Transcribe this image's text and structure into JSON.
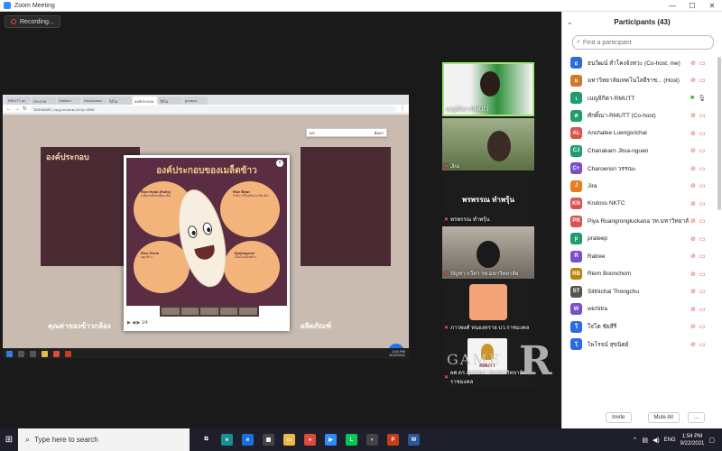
{
  "window": {
    "title": "Zoom Meeting",
    "minimize": "—",
    "maximize": "☐",
    "close": "✕"
  },
  "recording": {
    "label": "Recording..."
  },
  "shared_screen": {
    "tabs": [
      "RMUTT.ac",
      "ประกาศ",
      "Untitled",
      "Storyboard",
      "วิดีโอ",
      "องค์ประกอบ",
      "วิดีโอ",
      "product"
    ],
    "url": "ไม่ปลอดภัย | rspg.rmutt.ac.th/?p=4958",
    "find_bar": {
      "count": "0/0",
      "button": "ค้นหา"
    },
    "page": {
      "bg_title": "องค์ประกอบ",
      "bg_caption_left": "คุณค่าของข้าวกล้อง",
      "bg_caption_right": "ผลิตภัณฑ์",
      "lightbox": {
        "title": "องค์ประกอบของเมล็ดข้าว",
        "labels": [
          {
            "head": "Rice Husk (Hulls)",
            "text": "เปลือกแข็งห่อหุ้มเมล็ด"
          },
          {
            "head": "Rice Bran",
            "text": "รำข้าว มีไขมันและวิตามิน"
          },
          {
            "head": "Rice Germ",
            "text": "จมูกข้าว"
          },
          {
            "head": "Endosperm",
            "text": "เนื้อในเมล็ดข้าว"
          }
        ],
        "close": "×",
        "controls": "▶  ◀  ▶  1/4"
      },
      "messenger": "✉"
    },
    "taskbar_clock": {
      "time": "1:54 PM",
      "date": "9/22/2021"
    }
  },
  "gallery": [
    {
      "name": "เบญจิกิตา-RMUTT",
      "active": true,
      "mic_muted": false
    },
    {
      "name": "Jira",
      "active": false,
      "mic_muted": true
    },
    {
      "name": "พรพรรณ ทำพรุ้น",
      "active": false,
      "mic_muted": true,
      "center_text": "พรพรรณ ทำพรุ้น"
    },
    {
      "name": "บัญชา กวีลา  วท.มหาวิทยาลัย",
      "active": false,
      "mic_muted": true
    },
    {
      "name": "ภาวพงศ์ หนองทราย บว.ราชมงคล",
      "active": false,
      "mic_muted": true
    },
    {
      "name": "ผศ.ดร.สุวรรณา วท.มหาวิทยาลัยราชมงคล",
      "active": false,
      "mic_muted": true,
      "logo_text": "RMUTT"
    }
  ],
  "watermark": {
    "small": "GAME",
    "big": "R"
  },
  "participants": {
    "title": "Participants (43)",
    "search_placeholder": "Find a participant",
    "list": [
      {
        "initials": "ธ",
        "color": "#2d6cdf",
        "name": "ธนวัฒน์ สำโคงจังหวะ (Co-host, me)",
        "mic": "off",
        "cam": "off"
      },
      {
        "initials": "ม",
        "color": "#c97a2b",
        "name": "มหาวิทยาลัยเทคโนโลยีราช... (Host)",
        "mic": "off",
        "cam": "off"
      },
      {
        "initials": "เ",
        "color": "#1f9d6b",
        "name": "เบญจิกิตา-RMUTT",
        "mic": "on",
        "cam": "on"
      },
      {
        "initials": "ศ",
        "color": "#1f9d6b",
        "name": "ศักดิ์ณา-RMUTT (Co-host)",
        "mic": "off",
        "cam": "off"
      },
      {
        "initials": "AL",
        "color": "#d9534f",
        "name": "Anchalee Luengsrichai",
        "mic": "off",
        "cam": "off"
      },
      {
        "initials": "CJ",
        "color": "#1f9d6b",
        "name": "Chanakarn Jitsa-nguan",
        "mic": "off",
        "cam": "off"
      },
      {
        "initials": "C+",
        "color": "#7b4fc9",
        "name": "Charoensri วรรณะ",
        "mic": "off",
        "cam": "off"
      },
      {
        "initials": "J",
        "color": "#e67e22",
        "name": "Jira",
        "mic": "off",
        "cam": "off"
      },
      {
        "initials": "KN",
        "color": "#d9534f",
        "name": "Krutoss NKTC",
        "mic": "off",
        "cam": "off"
      },
      {
        "initials": "PR",
        "color": "#d9534f",
        "name": "Piya Ruangrongluckana วท.มหาวิทยาลัย",
        "mic": "off",
        "cam": "off"
      },
      {
        "initials": "p",
        "color": "#1f9d6b",
        "name": "prateep",
        "mic": "off",
        "cam": "off"
      },
      {
        "initials": "R",
        "color": "#7b4fc9",
        "name": "Ratree",
        "mic": "off",
        "cam": "off"
      },
      {
        "initials": "RB",
        "color": "#b8860b",
        "name": "Riem Boonchom",
        "mic": "off",
        "cam": "off"
      },
      {
        "initials": "ST",
        "color": "#555",
        "name": "Sitthichai Thongchu",
        "mic": "off",
        "cam": "off"
      },
      {
        "initials": "W",
        "color": "#7b4fc9",
        "name": "wichitra",
        "mic": "off",
        "cam": "off"
      },
      {
        "initials": "ใ",
        "color": "#2d6cdf",
        "name": "ใจ่โต ชัยสีรี",
        "mic": "off",
        "cam": "off"
      },
      {
        "initials": "โ",
        "color": "#2d6cdf",
        "name": "ไพโรจน์ สุขนิตย์",
        "mic": "off",
        "cam": "off"
      }
    ],
    "footer": {
      "invite": "Invite",
      "mute_all": "Mute All",
      "more": "..."
    }
  },
  "taskbar": {
    "search_placeholder": "Type here to search",
    "apps": [
      {
        "name": "task-view",
        "color": "#1f1f2b",
        "glyph": "⧉"
      },
      {
        "name": "edge",
        "color": "#1a8f8f",
        "glyph": "e"
      },
      {
        "name": "ie",
        "color": "#1e6fd9",
        "glyph": "e"
      },
      {
        "name": "store",
        "color": "#444",
        "glyph": "▦"
      },
      {
        "name": "explorer",
        "color": "#e8b84a",
        "glyph": "▭"
      },
      {
        "name": "chrome",
        "color": "#dd4b39",
        "glyph": "●"
      },
      {
        "name": "zoom",
        "color": "#2d8cff",
        "glyph": "▶"
      },
      {
        "name": "line",
        "color": "#06c755",
        "glyph": "L"
      },
      {
        "name": "photos",
        "color": "#444",
        "glyph": "◐"
      },
      {
        "name": "powerpoint",
        "color": "#c43e1c",
        "glyph": "P"
      },
      {
        "name": "word",
        "color": "#2b579a",
        "glyph": "W"
      }
    ],
    "lang": "ENG",
    "time": "1:54 PM",
    "date": "9/22/2021"
  }
}
